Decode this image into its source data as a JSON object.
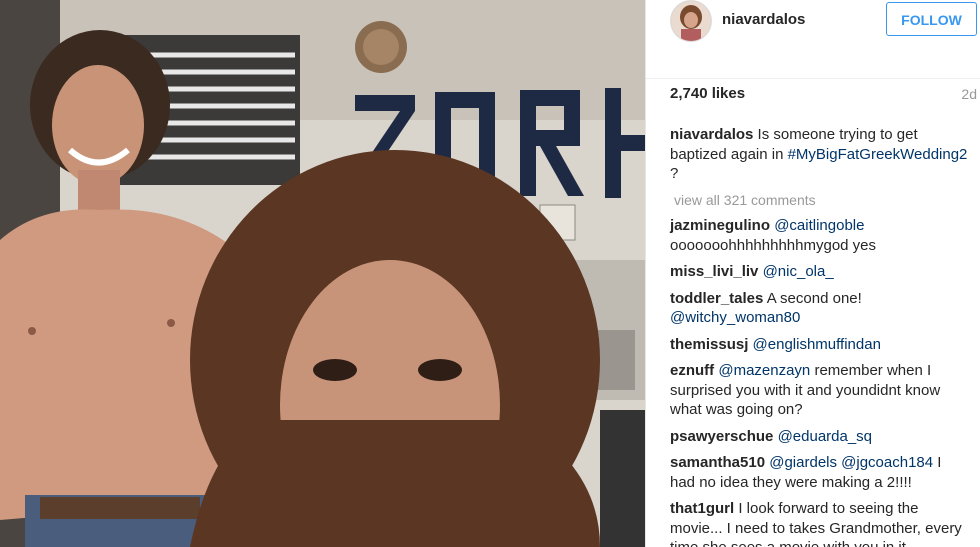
{
  "post": {
    "username": "niavardalos",
    "follow_label": "FOLLOW",
    "likes": "2,740 likes",
    "age": "2d"
  },
  "caption": {
    "user": "niavardalos",
    "text": " Is someone trying to get baptized again in ",
    "hashtag": "#MyBigFatGreekWedding2",
    "tail": " ?"
  },
  "view_all": "view all 321 comments",
  "comments": [
    {
      "user": "jazminegulino",
      "mention": "@caitlingoble",
      "text": " ooooooohhhhhhhhhmygod yes"
    },
    {
      "user": "miss_livi_liv",
      "mention": "@nic_ola_",
      "text": ""
    },
    {
      "user": "toddler_tales",
      "mention": "",
      "text": " A second one!",
      "mention2": "@witchy_woman80"
    },
    {
      "user": "themissusj",
      "mention": "@englishmuffindan",
      "text": ""
    },
    {
      "user": "eznuff",
      "mention": "@mazenzayn",
      "text": " remember when I surprised you with it and youndidnt know what was going on?"
    },
    {
      "user": "psawyerschue",
      "mention": "@eduarda_sq",
      "text": ""
    },
    {
      "user": "samantha510",
      "mention": "@giardels @jgcoach184",
      "text": " I had no idea they were making a 2!!!!"
    },
    {
      "user": "that1gurl",
      "mention": "",
      "text": " I look forward to seeing the movie... I need to takes Grandmother, every time she sees a movie with you in it"
    }
  ],
  "photo": {
    "sign_text": "ZORB"
  }
}
